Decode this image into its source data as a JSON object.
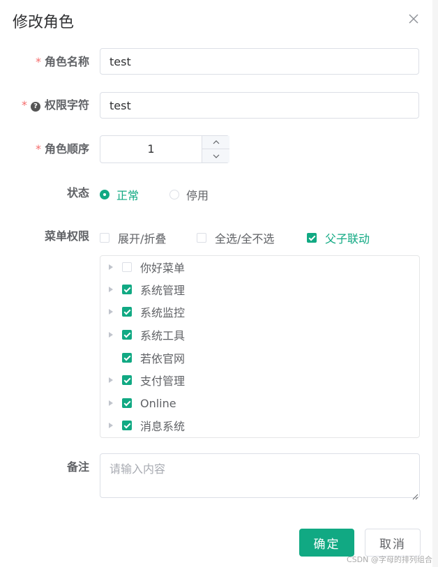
{
  "dialog": {
    "title": "修改角色"
  },
  "form": {
    "role_name": {
      "required_mark": "*",
      "label": "角色名称",
      "value": "test"
    },
    "permission_key": {
      "required_mark": "*",
      "help_icon": "?",
      "label": "权限字符",
      "value": "test"
    },
    "role_order": {
      "required_mark": "*",
      "label": "角色顺序",
      "value": "1"
    },
    "status": {
      "label": "状态",
      "options": [
        {
          "label": "正常",
          "selected": true
        },
        {
          "label": "停用",
          "selected": false
        }
      ]
    },
    "menu_permissions": {
      "label": "菜单权限",
      "options": [
        {
          "label": "展开/折叠",
          "checked": false
        },
        {
          "label": "全选/全不选",
          "checked": false
        },
        {
          "label": "父子联动",
          "checked": true
        }
      ],
      "tree": [
        {
          "label": "你好菜单",
          "checked": false,
          "expandable": true
        },
        {
          "label": "系统管理",
          "checked": true,
          "expandable": true
        },
        {
          "label": "系统监控",
          "checked": true,
          "expandable": true
        },
        {
          "label": "系统工具",
          "checked": true,
          "expandable": true
        },
        {
          "label": "若依官网",
          "checked": true,
          "expandable": false
        },
        {
          "label": "支付管理",
          "checked": true,
          "expandable": true
        },
        {
          "label": "Online",
          "checked": true,
          "expandable": true
        },
        {
          "label": "消息系统",
          "checked": true,
          "expandable": true
        }
      ]
    },
    "remark": {
      "label": "备注",
      "placeholder": "请输入内容",
      "value": ""
    }
  },
  "footer": {
    "confirm_label": "确定",
    "cancel_label": "取消"
  },
  "watermark": "CSDN @字母的排列组合",
  "colors": {
    "primary": "#11a983",
    "required": "#f56c6c",
    "border": "#dcdfe6"
  },
  "icons": {
    "close": "close-icon",
    "help": "question-circle-icon",
    "increase": "chevron-up-icon",
    "decrease": "chevron-down-icon",
    "tree_expand": "caret-right-icon"
  }
}
